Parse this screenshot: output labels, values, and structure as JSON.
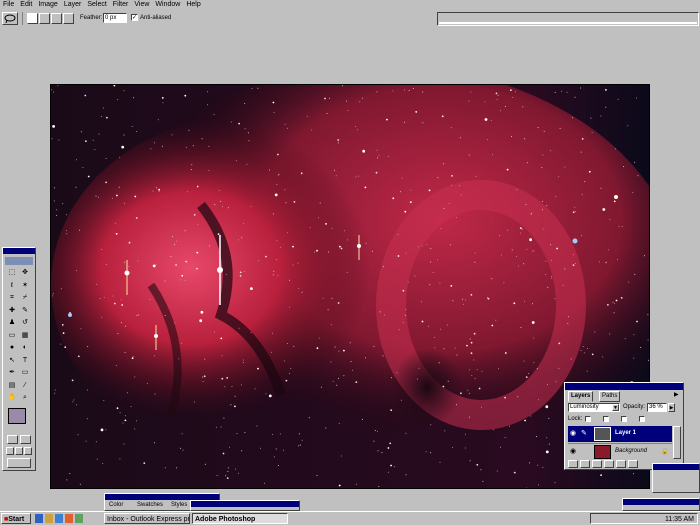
{
  "menu": {
    "items": [
      "File",
      "Edit",
      "Image",
      "Layer",
      "Select",
      "Filter",
      "View",
      "Window",
      "Help"
    ]
  },
  "options_bar": {
    "feather_label": "Feather:",
    "feather_value": "0 px",
    "antialiased_label": "Anti-aliased",
    "antialiased_checked": true
  },
  "layers_panel": {
    "tabs": [
      "Layers",
      "Paths"
    ],
    "blend_mode": "Luminosity",
    "opacity_label": "Opacity:",
    "opacity_value": "36 %",
    "lock_label": "Lock:",
    "layers": [
      {
        "name": "Layer 1",
        "selected": true
      },
      {
        "name": "Background",
        "selected": false
      }
    ]
  },
  "color_panel": {
    "tabs": [
      "Color",
      "Swatches",
      "Styles"
    ]
  },
  "taskbar": {
    "start_label": "Start",
    "tasks": [
      "Inbox - Outlook Express pr",
      "Adobe Photoshop"
    ],
    "clock": "11:35 AM"
  },
  "colors": {
    "title_bar": "#00007b",
    "chrome": "#c0c0c0",
    "nebula_red": "#c0203a"
  }
}
